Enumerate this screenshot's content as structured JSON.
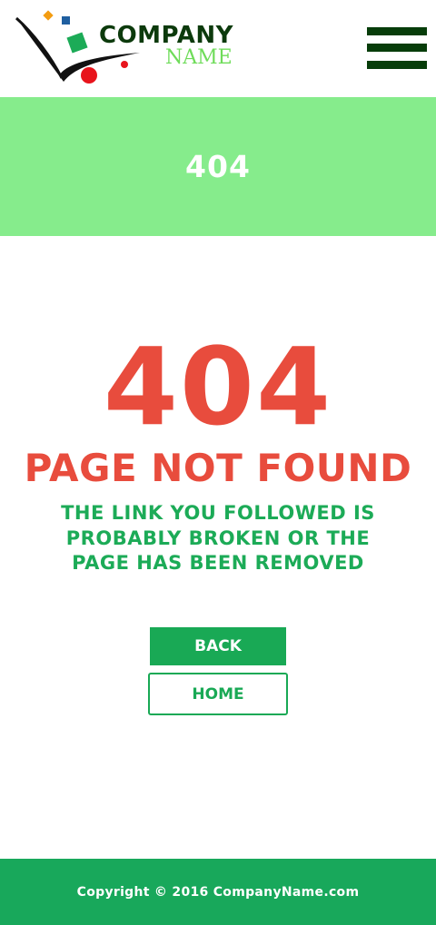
{
  "logo": {
    "line1": "COMPANY",
    "line2": "NAME"
  },
  "header": {
    "menu_icon": "hamburger-menu-icon"
  },
  "banner": {
    "title": "404"
  },
  "error": {
    "code": "404",
    "title": "PAGE NOT FOUND",
    "message": "THE LINK YOU FOLLOWED IS PROBABLY BROKEN OR THE PAGE HAS BEEN REMOVED"
  },
  "buttons": {
    "back_label": "BACK",
    "home_label": "HOME"
  },
  "footer": {
    "copyright": "Copyright © 2016 CompanyName.com"
  },
  "colors": {
    "banner_bg": "#86ec8c",
    "error_red": "#e84c3d",
    "brand_green": "#19a955",
    "menu_dark_green": "#073d0a"
  }
}
